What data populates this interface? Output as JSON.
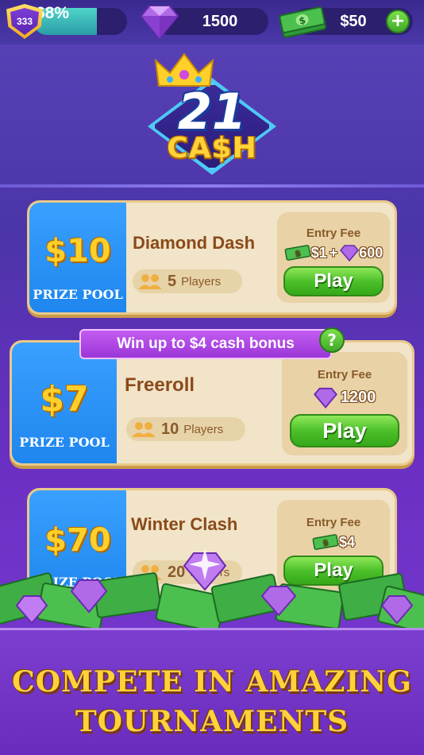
{
  "topbar": {
    "level": "333",
    "xp_percent_label": "68%",
    "xp_progress": 0.68,
    "gems": "1500",
    "cash": "$50",
    "add_cash_symbol": "+"
  },
  "logo": {
    "line1": "21",
    "line2": "CA$H"
  },
  "tournaments": [
    {
      "prize": "$10",
      "prize_label": "PRIZE POOL",
      "name": "Diamond Dash",
      "players_count": "5",
      "players_label": "Players",
      "entry_fee_label": "Entry Fee",
      "fee_cash": "$1",
      "fee_plus": "+",
      "fee_gems": "600",
      "play_label": "Play"
    },
    {
      "bonus_text": "Win up to $4 cash bonus",
      "help_symbol": "?",
      "prize": "$7",
      "prize_label": "PRIZE POOL",
      "name": "Freeroll",
      "players_count": "10",
      "players_label": "Players",
      "entry_fee_label": "Entry Fee",
      "fee_gems": "1200",
      "play_label": "Play"
    },
    {
      "prize": "$70",
      "prize_label": "PRIZE POOL",
      "name": "Winter Clash",
      "players_count": "20",
      "players_label": "Players",
      "entry_fee_label": "Entry Fee",
      "fee_cash": "$4",
      "play_label": "Play"
    }
  ],
  "footer": {
    "line1": "COMPETE IN AMAZING",
    "line2": "TOURNAMENTS"
  },
  "colors": {
    "accent_green": "#4cc02a",
    "prize_blue": "#1e86ee",
    "gold": "#ffd23a",
    "purple": "#6a2cbd"
  }
}
